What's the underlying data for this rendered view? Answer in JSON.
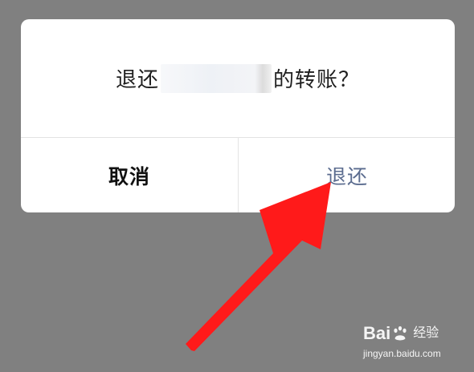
{
  "dialog": {
    "message_prefix": "退还",
    "message_suffix": "的转账？",
    "cancel_label": "取消",
    "confirm_label": "退还"
  },
  "watermark": {
    "brand_left": "Bai",
    "brand_right": "经验",
    "url": "jingyan.baidu.com"
  },
  "colors": {
    "overlay": "#808080",
    "dialog_bg": "#ffffff",
    "confirm_text": "#5b6c8f",
    "arrow": "#ff1a1a"
  },
  "icons": {
    "arrow": "red-arrow-icon",
    "watermark_logo": "baidu-paw-icon"
  }
}
